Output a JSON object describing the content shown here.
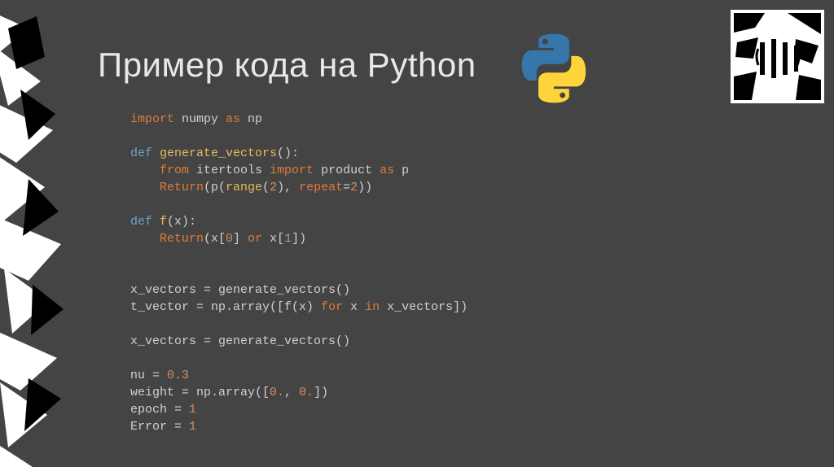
{
  "title": "Пример кода на Python",
  "code": {
    "l01a": "import",
    "l01b": " numpy ",
    "l01c": "as",
    "l01d": " np",
    "l03a": "def ",
    "l03b": "generate_vectors",
    "l03c": "():",
    "l04a": "    from",
    "l04b": " itertools ",
    "l04c": "import",
    "l04d": " product ",
    "l04e": "as",
    "l04f": " p",
    "l05a": "    Return",
    "l05b": "(p(",
    "l05c": "range",
    "l05d": "(",
    "l05e": "2",
    "l05f": "), ",
    "l05g": "repeat",
    "l05h": "=",
    "l05i": "2",
    "l05j": "))",
    "l07a": "def ",
    "l07b": "f",
    "l07c": "(x):",
    "l08a": "    Return",
    "l08b": "(x[",
    "l08c": "0",
    "l08d": "] ",
    "l08e": "or",
    "l08f": " x[",
    "l08g": "1",
    "l08h": "])",
    "l11": "x_vectors = generate_vectors()",
    "l12a": "t_vector = np.array([f(x) ",
    "l12b": "for",
    "l12c": " x ",
    "l12d": "in",
    "l12e": " x_vectors])",
    "l14": "x_vectors = generate_vectors()",
    "l16a": "nu = ",
    "l16b": "0.3",
    "l17a": "weight = np.array([",
    "l17b": "0.",
    "l17c": ", ",
    "l17d": "0.",
    "l17e": "])",
    "l18a": "epoch = ",
    "l18b": "1",
    "l19a": "Error = ",
    "l19b": "1"
  }
}
